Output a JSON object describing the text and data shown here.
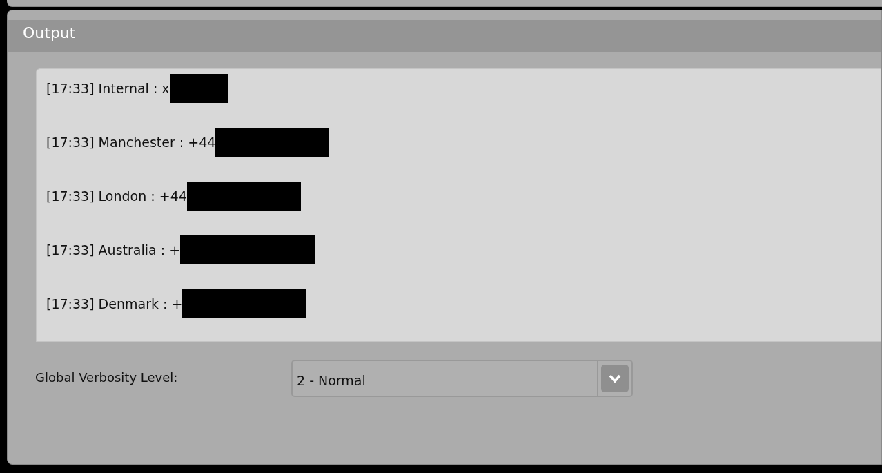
{
  "panel": {
    "title": "Output"
  },
  "log": [
    {
      "text": "[17:33] Internal : x",
      "redacted": true
    },
    {
      "text": "[17:33] Manchester : +44",
      "redacted": true
    },
    {
      "text": "[17:33] London : +44",
      "redacted": true
    },
    {
      "text": "[17:33] Australia : +",
      "redacted": true
    },
    {
      "text": "[17:33] Denmark : +",
      "redacted": true
    }
  ],
  "verbosity": {
    "label": "Global Verbosity Level:",
    "value": "2 - Normal"
  }
}
